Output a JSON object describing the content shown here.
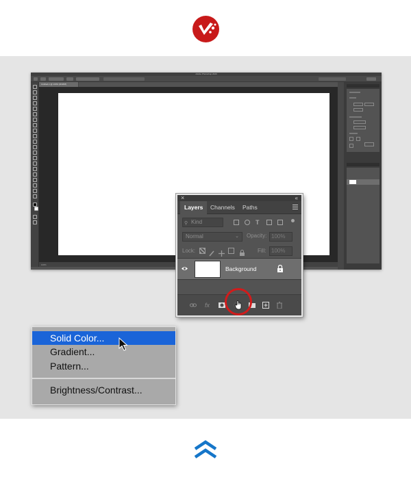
{
  "colors": {
    "logo": "#c81a1a",
    "accent": "#1a64d8",
    "highlight": "#d21b1b",
    "chevron": "#1576c9"
  },
  "icons": {
    "logo": "brand-logo-icon",
    "back_to_top": "double-chevron-up-icon"
  },
  "photoshop": {
    "window_title": "Adobe Photoshop 2020",
    "doc_tab": "Untitled-1 @ 100% (RGB/8)",
    "status": "100%"
  },
  "layers_panel": {
    "tabs": [
      "Layers",
      "Channels",
      "Paths"
    ],
    "active_tab": "Layers",
    "filter_placeholder": "Kind",
    "blend_mode": "Normal",
    "opacity_label": "Opacity:",
    "opacity_value": "100%",
    "lock_label": "Lock:",
    "fill_label": "Fill:",
    "fill_value": "100%",
    "layer_name": "Background"
  },
  "adjustment_menu": {
    "items": [
      "Solid Color...",
      "Gradient...",
      "Pattern...",
      "Brightness/Contrast..."
    ],
    "selected": "Solid Color..."
  }
}
